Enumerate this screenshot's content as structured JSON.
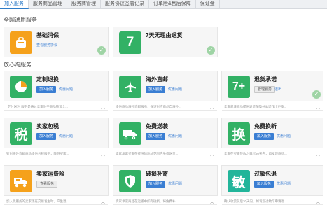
{
  "tabs": [
    {
      "label": "加入服务",
      "active": true
    },
    {
      "label": "服务商品管理",
      "active": false
    },
    {
      "label": "服务商管理",
      "active": false
    },
    {
      "label": "服务协议签署记录",
      "active": false
    },
    {
      "label": "订单险&售后保障",
      "active": false
    },
    {
      "label": "保证金",
      "active": false
    }
  ],
  "sections": {
    "general": "全网通用服务",
    "assured": "放心淘服务"
  },
  "general_cards": [
    {
      "name": "基础消保",
      "link": "查看服务协议",
      "icon": "bag-icon",
      "color": "#f5a11b",
      "joined": true
    },
    {
      "name": "7天无理由退货",
      "glyph": "7",
      "icon": "seven-day-icon",
      "color": "#32b165",
      "joined": true
    }
  ],
  "assured_cards": [
    {
      "name": "定制退换",
      "button": "加入服务",
      "button_style": "blue",
      "link": "优惠问题",
      "icon": "pie-chart-icon",
      "color": "#32b165",
      "desc": "\"定时送达\"服务是通过卖家对于商品物流全..."
    },
    {
      "name": "海外直邮",
      "button": "加入服务",
      "button_style": "blue",
      "link": "优惠问题",
      "icon": "airplane-icon",
      "color": "#32b165",
      "desc": "提供商品海外直邮服务，保证对应商品自海外..."
    },
    {
      "name": "退货承诺",
      "button": "管理服务",
      "button_style": "gray",
      "link": "退出",
      "glyph": "7+",
      "icon": "seven-plus-icon",
      "color": "#32b165",
      "desc": "卖家就该商品提供退货保障并承诺作出更多...",
      "joined": true
    },
    {
      "name": "卖家包税",
      "button": "加入服务",
      "button_style": "blue",
      "link": "优惠问题",
      "glyph": "税",
      "icon": "tax-icon",
      "color": "#32b165",
      "desc": "针对海外直邮商品提供包税服务，降低买家..."
    },
    {
      "name": "免费送装",
      "button": "加入服务",
      "button_style": "blue",
      "link": "优惠问题",
      "icon": "truck-icon",
      "color": "#32b165",
      "desc": "卖家承诺买家在提供的地址范围内免费送货..."
    },
    {
      "name": "免费换新",
      "button": "加入服务",
      "button_style": "blue",
      "link": "优惠问题",
      "glyph": "换",
      "icon": "exchange-icon",
      "color": "#32b165",
      "desc": "卖家在买家签收之日起30天内，如发现商品..."
    },
    {
      "name": "卖家运费险",
      "button": "查看服务",
      "button_style": "gray",
      "link": "",
      "icon": "shipping-insurance-icon",
      "color": "#f5a11b",
      "desc": "加入此服务的卖家须在交易发生时，产生退..."
    },
    {
      "name": "破损补寄",
      "button": "加入服务",
      "button_style": "blue",
      "link": "优惠问题",
      "icon": "shield-icon",
      "color": "#32b165",
      "desc": "卖家承诺商品在运输中如有破损，将免费补..."
    },
    {
      "name": "过敏包退",
      "button": "加入服务",
      "button_style": "blue",
      "link": "优惠问题",
      "glyph": "敏",
      "icon": "allergy-icon",
      "color": "#32b165",
      "desc": "确认收货前后30天内，如发现过敏可申请退..."
    }
  ]
}
